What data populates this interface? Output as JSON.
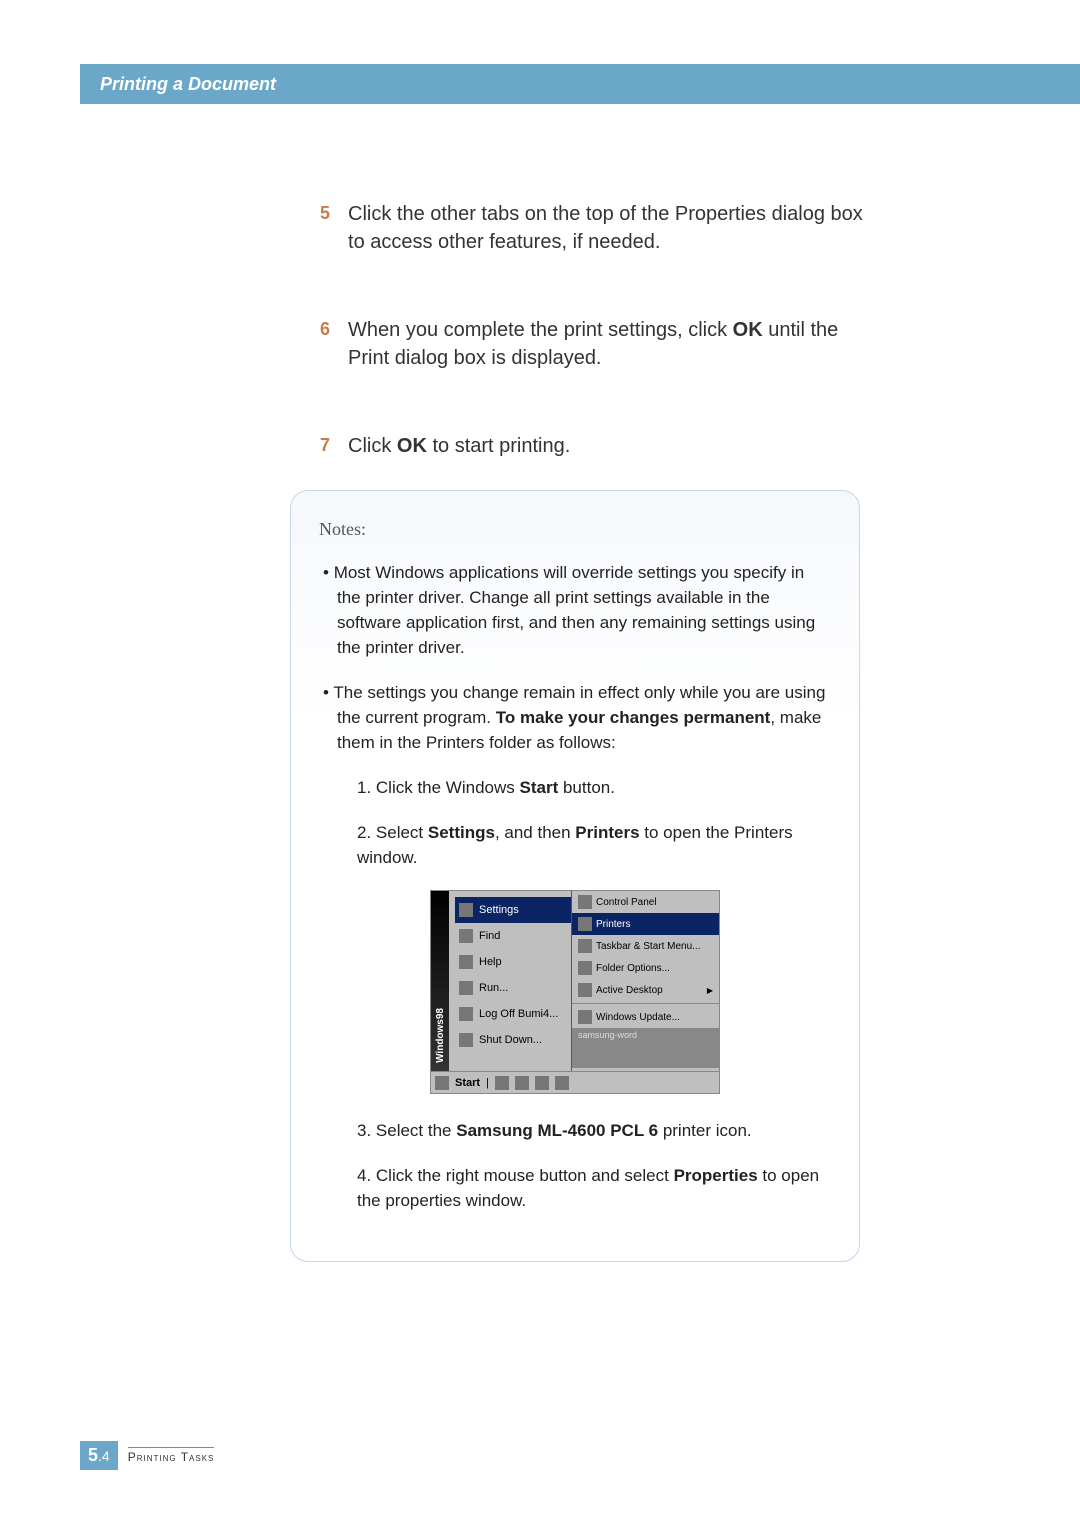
{
  "header": {
    "title": "Printing a Document"
  },
  "steps": [
    {
      "number": "5",
      "text": "Click the other tabs on the top of the Properties dialog box to access other features, if needed."
    },
    {
      "number": "6",
      "text_before": "When you complete the print settings, click ",
      "bold1": "OK",
      "text_after": " until the Print dialog box is displayed."
    },
    {
      "number": "7",
      "text_before": "Click ",
      "bold1": "OK",
      "text_after": " to start printing."
    }
  ],
  "notes": {
    "title": "Notes:",
    "bullet1": "Most Windows applications will override settings you specify in the printer driver. Change all print settings available in the software application first, and then any remaining settings using the printer driver.",
    "bullet2_before": "The settings you change remain in effect only while you are using the current program. ",
    "bullet2_bold": "To make your changes permanent",
    "bullet2_after": ", make them in the Printers folder as follows:",
    "num1_before": "1. Click the Windows ",
    "num1_bold": "Start",
    "num1_after": " button.",
    "num2_before": "2. Select ",
    "num2_bold1": "Settings",
    "num2_mid": ", and then ",
    "num2_bold2": "Printers",
    "num2_after": " to open the Printers window.",
    "num3_before": "3. Select the ",
    "num3_bold": "Samsung ML-4600 PCL 6",
    "num3_after": " printer icon.",
    "num4_before": "4. Click the right mouse button and select ",
    "num4_bold": "Properties",
    "num4_after": " to open the properties window."
  },
  "screenshot": {
    "sidebar": "Windows98",
    "left_menu": {
      "settings": "Settings",
      "find": "Find",
      "help": "Help",
      "run": "Run...",
      "logoff": "Log Off Bumi4...",
      "shutdown": "Shut Down..."
    },
    "right_menu": {
      "control_panel": "Control Panel",
      "printers": "Printers",
      "taskbar": "Taskbar & Start Menu...",
      "folder_options": "Folder Options...",
      "active_desktop": "Active Desktop",
      "windows_update": "Windows Update...",
      "samsung": "samsung-word"
    },
    "taskbar": {
      "start": "Start"
    }
  },
  "footer": {
    "page_major": "5",
    "page_minor": ".4",
    "section": "Printing Tasks"
  }
}
